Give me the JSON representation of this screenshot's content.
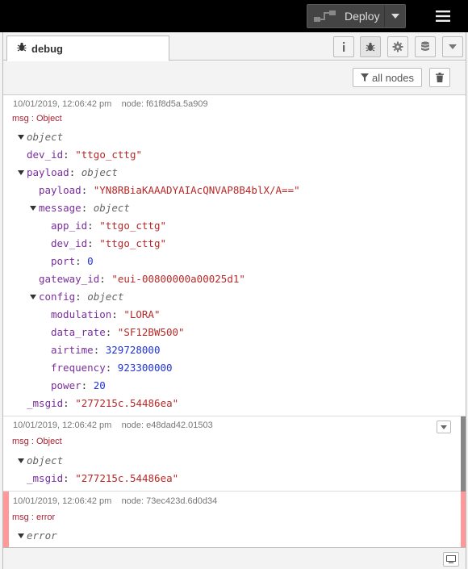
{
  "header": {
    "deploy_label": "Deploy"
  },
  "tab": {
    "label": "debug"
  },
  "toolbar": {
    "filter_label": "all nodes"
  },
  "messages": [
    {
      "timestamp": "10/01/2019, 12:06:42 pm",
      "node": "node: f61f8d5a.5a909",
      "type": "msg : Object",
      "tree": {
        "root": "object",
        "dev_id_key": "dev_id",
        "dev_id_val": "\"ttgo_cttg\"",
        "payload_key": "payload",
        "payload_type": "object",
        "payload_payload_key": "payload",
        "payload_payload_val": "\"YN8RBiaKAAADYAIAcQNVAP8B4blX/A==\"",
        "message_key": "message",
        "message_type": "object",
        "app_id_key": "app_id",
        "app_id_val": "\"ttgo_cttg\"",
        "m_dev_id_key": "dev_id",
        "m_dev_id_val": "\"ttgo_cttg\"",
        "port_key": "port",
        "port_val": "0",
        "gateway_id_key": "gateway_id",
        "gateway_id_val": "\"eui-00800000a00025d1\"",
        "config_key": "config",
        "config_type": "object",
        "modulation_key": "modulation",
        "modulation_val": "\"LORA\"",
        "data_rate_key": "data_rate",
        "data_rate_val": "\"SF12BW500\"",
        "airtime_key": "airtime",
        "airtime_val": "329728000",
        "frequency_key": "frequency",
        "frequency_val": "923300000",
        "power_key": "power",
        "power_val": "20",
        "msgid_key": "_msgid",
        "msgid_val": "\"277215c.54486ea\""
      }
    },
    {
      "timestamp": "10/01/2019, 12:06:42 pm",
      "node": "node: e48dad42.01503",
      "type": "msg : Object",
      "tree": {
        "root": "object",
        "msgid_key": "_msgid",
        "msgid_val": "\"277215c.54486ea\""
      }
    },
    {
      "timestamp": "10/01/2019, 12:06:42 pm",
      "node": "node: 73ec423d.6d0d34",
      "type": "msg : error",
      "tree": {
        "root": "error"
      }
    }
  ],
  "colors": {
    "key": "#792e9d",
    "string": "#b72828",
    "number": "#2033d6",
    "error_bar": "#f99"
  },
  "icons": [
    "deploy-icon",
    "caret-down-icon",
    "hamburger-menu-icon",
    "bug-icon",
    "info-icon",
    "gear-icon",
    "database-icon",
    "filter-icon",
    "trash-icon",
    "monitor-icon"
  ]
}
